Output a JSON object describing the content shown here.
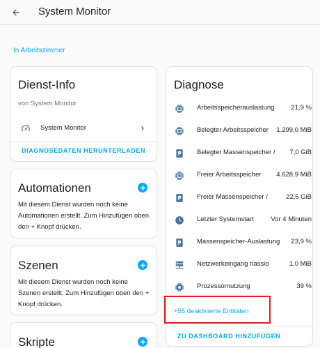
{
  "topbar": {
    "title": "System Monitor"
  },
  "breadcrumb": "In Arbeitszimmer",
  "dienst_info": {
    "title": "Dienst-Info",
    "subtitle": "von System Monitor",
    "device_name": "System Monitor",
    "download_label": "DIAGNOSEDATEN HERUNTERLADEN"
  },
  "automationen": {
    "title": "Automationen",
    "text": "Mit diesem Dienst wurden noch keine Automationen erstellt. Zum Hinzufügen oben den + Knopf drücken."
  },
  "szenen": {
    "title": "Szenen",
    "text": "Mit diesem Dienst wurden noch keine Szenen erstellt. Zum Hinzufügen oben den + Knopf drücken."
  },
  "skripte": {
    "title": "Skripte"
  },
  "diagnose": {
    "title": "Diagnose",
    "rows": [
      {
        "icon": "chip-icon",
        "name": "Arbeitsspeicherauslastung",
        "value": "21,9 %"
      },
      {
        "icon": "chip-icon",
        "name": "Belegter Arbeitsspeicher",
        "value": "1.299,0 MiB"
      },
      {
        "icon": "harddisk-icon",
        "name": "Belegter Massenspeicher / ",
        "value": "7,0 GiB"
      },
      {
        "icon": "chip-icon",
        "name": "Freier Arbeitsspeicher",
        "value": "4.628,9 MiB"
      },
      {
        "icon": "harddisk-icon",
        "name": "Freier Massenspeicher /",
        "value": "22,5 GiB"
      },
      {
        "icon": "clock-icon",
        "name": "Letzter Systemstart",
        "value": "Vor 4 Minuten"
      },
      {
        "icon": "harddisk-icon",
        "name": "Massenspeicher-Auslastung",
        "value": "23,9 %"
      },
      {
        "icon": "server-network-icon",
        "name": "Netzwerkeingang hassio",
        "value": "1,0 MiB"
      },
      {
        "icon": "cpu-icon",
        "name": "Prozessornutzung",
        "value": "39 %"
      }
    ],
    "disabled_entities": "+55 deaktivierte Entitäten",
    "add_dashboard": "ZU DASHBOARD HINZUFÜGEN"
  },
  "colors": {
    "accent": "#03a9f4",
    "highlight": "#e8191c",
    "icon": "#44739e"
  }
}
